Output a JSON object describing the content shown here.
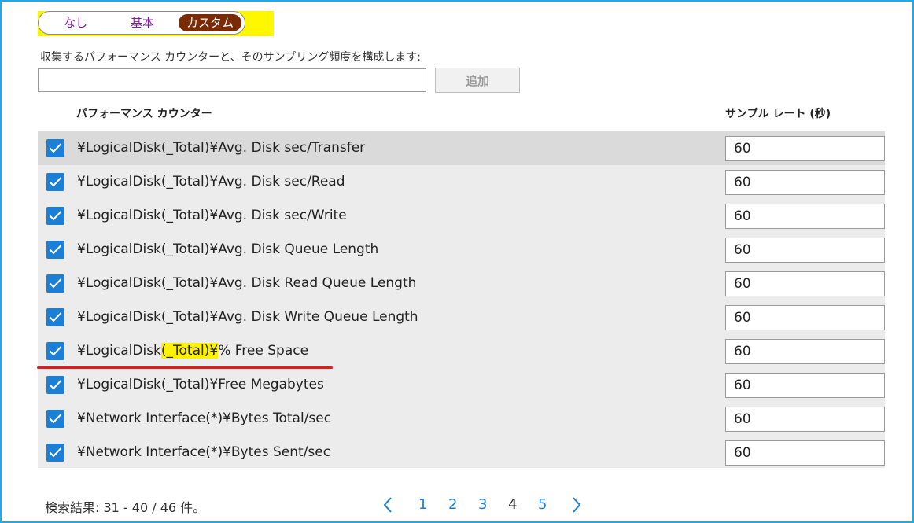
{
  "toggle": {
    "none": "なし",
    "basic": "基本",
    "custom": "カスタム",
    "selected": "カスタム"
  },
  "description": "収集するパフォーマンス カウンターと、そのサンプリング頻度を構成します:",
  "search": {
    "value": "",
    "placeholder": ""
  },
  "add_button": "追加",
  "headers": {
    "counter": "パフォーマンス カウンター",
    "rate": "サンプル レート (秒)"
  },
  "rows": [
    {
      "checked": true,
      "counter": "¥LogicalDisk(_Total)¥Avg. Disk sec/Transfer",
      "rate": "60",
      "selected": true
    },
    {
      "checked": true,
      "counter": "¥LogicalDisk(_Total)¥Avg. Disk sec/Read",
      "rate": "60"
    },
    {
      "checked": true,
      "counter": "¥LogicalDisk(_Total)¥Avg. Disk sec/Write",
      "rate": "60"
    },
    {
      "checked": true,
      "counter": "¥LogicalDisk(_Total)¥Avg. Disk Queue Length",
      "rate": "60"
    },
    {
      "checked": true,
      "counter": "¥LogicalDisk(_Total)¥Avg. Disk Read Queue Length",
      "rate": "60"
    },
    {
      "checked": true,
      "counter": "¥LogicalDisk(_Total)¥Avg. Disk Write Queue Length",
      "rate": "60"
    },
    {
      "checked": true,
      "counter_parts": [
        "¥LogicalDisk",
        "(_Total)¥",
        "% Free Space"
      ],
      "counter": "¥LogicalDisk(_Total)¥% Free Space",
      "rate": "60"
    },
    {
      "checked": true,
      "counter": "¥LogicalDisk(_Total)¥Free Megabytes",
      "rate": "60"
    },
    {
      "checked": true,
      "counter": "¥Network Interface(*)¥Bytes Total/sec",
      "rate": "60"
    },
    {
      "checked": true,
      "counter": "¥Network Interface(*)¥Bytes Sent/sec",
      "rate": "60"
    }
  ],
  "results": "検索結果: 31 - 40 / 46 件。",
  "pagination": {
    "prev": "〈",
    "pages": [
      "1",
      "2",
      "3",
      "4",
      "5"
    ],
    "current": "4",
    "next": "〉"
  },
  "colors": {
    "accent": "#1c7fd6",
    "toggle_selected": "#7a2a05",
    "highlight": "#fff200",
    "underline": "#e01b1b",
    "frame": "#22a8e8"
  },
  "icons": {
    "checkbox": "check-icon",
    "prev": "chevron-left-icon",
    "next": "chevron-right-icon"
  }
}
